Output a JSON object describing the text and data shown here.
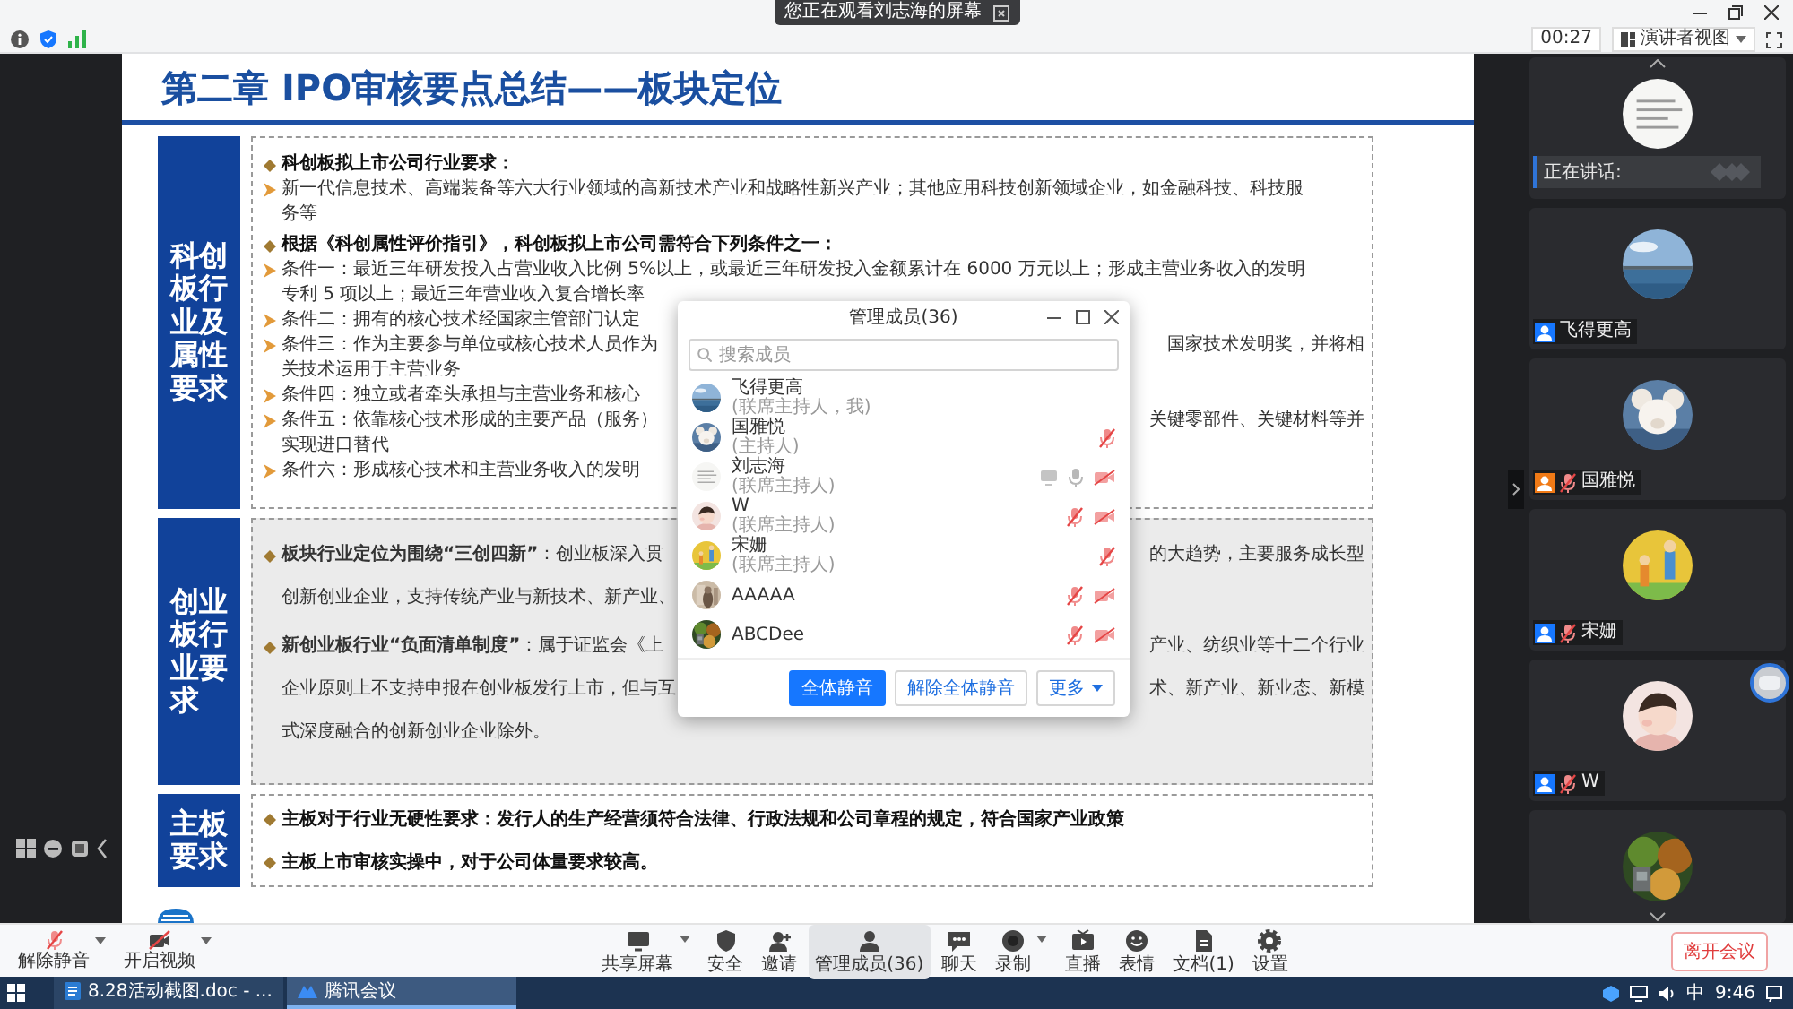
{
  "top_bar": {
    "notice": "您正在观看刘志海的屏幕",
    "timer": "00:27",
    "view_button": "演讲者视图"
  },
  "slide": {
    "title": "第二章 IPO审核要点总结——板块定位",
    "sections": [
      {
        "label": "科创板行业及属性要求",
        "shaded": false,
        "lines": [
          {
            "kind": "heading",
            "text": "科创板拟上市公司行业要求："
          },
          {
            "kind": "point",
            "text": "新一代信息技术、高端装备等六大行业领域的高新技术产业和战略性新兴产业；其他应用科技创新领域企业，如金融科技、科技服"
          },
          {
            "kind": "cont",
            "text": "务等"
          },
          {
            "kind": "heading",
            "text": "根据《科创属性评价指引》，科创板拟上市公司需符合下列条件之一："
          },
          {
            "kind": "point",
            "text": "条件一：最近三年研发投入占营业收入比例 5%以上，或最近三年研发投入金额累计在 6000 万元以上；形成主营业务收入的发明"
          },
          {
            "kind": "cont",
            "text": "专利 5 项以上；最近三年营业收入复合增长率"
          },
          {
            "kind": "point",
            "text": "条件二：拥有的核心技术经国家主管部门认定"
          },
          {
            "kind": "point",
            "text": "条件三：作为主要参与单位或核心技术人员作为",
            "right": "国家技术发明奖，并将相"
          },
          {
            "kind": "cont",
            "text": "关技术运用于主营业务"
          },
          {
            "kind": "point",
            "text": "条件四：独立或者牵头承担与主营业务和核心"
          },
          {
            "kind": "point",
            "text": "条件五：依靠核心技术形成的主要产品（服务）",
            "right": "关键零部件、关键材料等并"
          },
          {
            "kind": "cont",
            "text": "实现进口替代"
          },
          {
            "kind": "point",
            "text": "条件六：形成核心技术和主营业务收入的发明"
          }
        ]
      },
      {
        "label": "创业板行业要求",
        "shaded": true,
        "lines": [
          {
            "kind": "lead",
            "text": "**板块行业定位为围绕“三创四新”**：创业板深入贯",
            "right": "的大趋势，主要服务成长型"
          },
          {
            "kind": "cont",
            "text": "创新创业企业，支持传统产业与新技术、新产业、"
          },
          {
            "kind": "lead",
            "text": "**新创业板行业“负面清单制度”**：属于证监会《上",
            "right": "产业、纺织业等十二个行业"
          },
          {
            "kind": "cont",
            "text": "企业原则上不支持申报在创业板发行上市，但与互",
            "right": "术、新产业、新业态、新模"
          },
          {
            "kind": "cont",
            "text": "式深度融合的创新创业企业除外。"
          }
        ]
      },
      {
        "label": "主板要求",
        "shaded": false,
        "lines": [
          {
            "kind": "heading",
            "text": "主板对于行业无硬性要求：发行人的生产经营须符合法律、行政法规和公司章程的规定，符合国家产业政策"
          },
          {
            "kind": "heading",
            "text": "主板上市审核实操中，对于公司体量要求较高。"
          }
        ]
      }
    ]
  },
  "members_dialog": {
    "title": "管理成员(36)",
    "search_placeholder": "搜索成员",
    "members": [
      {
        "kind": "self",
        "name": "飞得更高",
        "role": "(联席主持人，我)"
      },
      {
        "kind": "member",
        "name": "国雅悦",
        "role": "(主持人)",
        "sharing": false,
        "muted": true,
        "camera_off": false
      },
      {
        "kind": "member",
        "name": "刘志海",
        "role": "(联席主持人)",
        "sharing": true,
        "muted": false,
        "camera_off": true
      },
      {
        "kind": "member",
        "name": "W",
        "role": "(联席主持人)",
        "sharing": false,
        "muted": true,
        "camera_off": true
      },
      {
        "kind": "member",
        "name": "宋姗",
        "role": "(联席主持人)",
        "sharing": false,
        "muted": true,
        "camera_off": false
      },
      {
        "kind": "member",
        "name": "AAAAA",
        "sharing": false,
        "muted": true,
        "camera_off": true
      },
      {
        "kind": "member",
        "name": "ABCDee",
        "sharing": false,
        "muted": true,
        "camera_off": true
      }
    ],
    "buttons": [
      {
        "label": "全体静音",
        "primary": true,
        "menu": false
      },
      {
        "label": "解除全体静音",
        "primary": false,
        "menu": false
      },
      {
        "label": "更多",
        "primary": false,
        "menu": true
      }
    ]
  },
  "right_panel": {
    "tiles": [
      {
        "kind": "speaker",
        "label": "正在讲话:"
      },
      {
        "kind": "member",
        "name": "飞得更高",
        "color": "#1677ff",
        "muted": false
      },
      {
        "kind": "member",
        "name": "国雅悦",
        "color": "#f07a16",
        "muted": true
      },
      {
        "kind": "member",
        "name": "宋姗",
        "color": "#1677ff",
        "muted": true
      },
      {
        "kind": "member",
        "name": "W",
        "color": "#1677ff",
        "muted": true
      },
      {
        "kind": "avatar"
      }
    ]
  },
  "toolbar": {
    "left": [
      {
        "label": "解除静音",
        "menu": true
      },
      {
        "label": "开启视频",
        "menu": true
      }
    ],
    "items": [
      {
        "label": "共享屏幕",
        "menu": true,
        "selected": false
      },
      {
        "label": "安全",
        "menu": false,
        "selected": false
      },
      {
        "label": "邀请",
        "menu": false,
        "selected": false
      },
      {
        "label": "管理成员(36)",
        "menu": false,
        "selected": true
      },
      {
        "label": "聊天",
        "menu": false,
        "selected": false
      },
      {
        "label": "录制",
        "menu": true,
        "selected": false
      },
      {
        "label": "直播",
        "menu": false,
        "selected": false
      },
      {
        "label": "表情",
        "menu": false,
        "selected": false
      },
      {
        "label": "文档(1)",
        "menu": false,
        "selected": false
      },
      {
        "label": "设置",
        "menu": false,
        "selected": false
      }
    ],
    "leave_button": "离开会议"
  },
  "taskbar": {
    "items": [
      {
        "label": "8.28活动截图.doc - ...",
        "selected": false
      },
      {
        "label": "腾讯会议",
        "selected": true
      }
    ],
    "ime": "中",
    "clock": "9:46"
  }
}
